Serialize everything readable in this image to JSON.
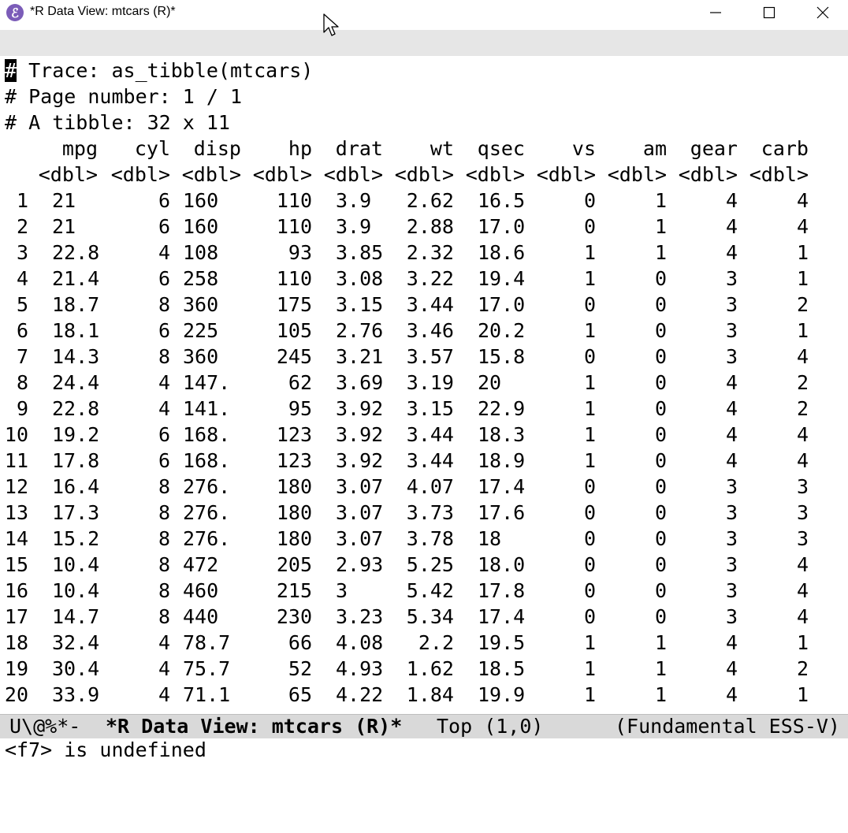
{
  "window": {
    "title": "*R Data View: mtcars (R)*",
    "app_icon_glyph": "ℰ",
    "buttons": [
      "minimize-icon",
      "maximize-icon",
      "close-icon"
    ]
  },
  "header_lines": {
    "trace_hash": "#",
    "trace_rest": " Trace: as_tibble(mtcars)",
    "page": "# Page number: 1 / 1",
    "tibble": "# A tibble: 32 x 11"
  },
  "table": {
    "columns": [
      "mpg",
      "cyl",
      "disp",
      "hp",
      "drat",
      "wt",
      "qsec",
      "vs",
      "am",
      "gear",
      "carb"
    ],
    "types": [
      "<dbl>",
      "<dbl>",
      "<dbl>",
      "<dbl>",
      "<dbl>",
      "<dbl>",
      "<dbl>",
      "<dbl>",
      "<dbl>",
      "<dbl>",
      "<dbl>"
    ],
    "rows": [
      [
        "1",
        "21",
        "6",
        "160",
        "110",
        "3.9",
        "2.62",
        "16.5",
        "0",
        "1",
        "4",
        "4"
      ],
      [
        "2",
        "21",
        "6",
        "160",
        "110",
        "3.9",
        "2.88",
        "17.0",
        "0",
        "1",
        "4",
        "4"
      ],
      [
        "3",
        "22.8",
        "4",
        "108",
        "93",
        "3.85",
        "2.32",
        "18.6",
        "1",
        "1",
        "4",
        "1"
      ],
      [
        "4",
        "21.4",
        "6",
        "258",
        "110",
        "3.08",
        "3.22",
        "19.4",
        "1",
        "0",
        "3",
        "1"
      ],
      [
        "5",
        "18.7",
        "8",
        "360",
        "175",
        "3.15",
        "3.44",
        "17.0",
        "0",
        "0",
        "3",
        "2"
      ],
      [
        "6",
        "18.1",
        "6",
        "225",
        "105",
        "2.76",
        "3.46",
        "20.2",
        "1",
        "0",
        "3",
        "1"
      ],
      [
        "7",
        "14.3",
        "8",
        "360",
        "245",
        "3.21",
        "3.57",
        "15.8",
        "0",
        "0",
        "3",
        "4"
      ],
      [
        "8",
        "24.4",
        "4",
        "147.",
        "62",
        "3.69",
        "3.19",
        "20",
        "1",
        "0",
        "4",
        "2"
      ],
      [
        "9",
        "22.8",
        "4",
        "141.",
        "95",
        "3.92",
        "3.15",
        "22.9",
        "1",
        "0",
        "4",
        "2"
      ],
      [
        "10",
        "19.2",
        "6",
        "168.",
        "123",
        "3.92",
        "3.44",
        "18.3",
        "1",
        "0",
        "4",
        "4"
      ],
      [
        "11",
        "17.8",
        "6",
        "168.",
        "123",
        "3.92",
        "3.44",
        "18.9",
        "1",
        "0",
        "4",
        "4"
      ],
      [
        "12",
        "16.4",
        "8",
        "276.",
        "180",
        "3.07",
        "4.07",
        "17.4",
        "0",
        "0",
        "3",
        "3"
      ],
      [
        "13",
        "17.3",
        "8",
        "276.",
        "180",
        "3.07",
        "3.73",
        "17.6",
        "0",
        "0",
        "3",
        "3"
      ],
      [
        "14",
        "15.2",
        "8",
        "276.",
        "180",
        "3.07",
        "3.78",
        "18",
        "0",
        "0",
        "3",
        "3"
      ],
      [
        "15",
        "10.4",
        "8",
        "472",
        "205",
        "2.93",
        "5.25",
        "18.0",
        "0",
        "0",
        "3",
        "4"
      ],
      [
        "16",
        "10.4",
        "8",
        "460",
        "215",
        "3",
        "5.42",
        "17.8",
        "0",
        "0",
        "3",
        "4"
      ],
      [
        "17",
        "14.7",
        "8",
        "440",
        "230",
        "3.23",
        "5.34",
        "17.4",
        "0",
        "0",
        "3",
        "4"
      ],
      [
        "18",
        "32.4",
        "4",
        "78.7",
        "66",
        "4.08",
        "2.2",
        "19.5",
        "1",
        "1",
        "4",
        "1"
      ],
      [
        "19",
        "30.4",
        "4",
        "75.7",
        "52",
        "4.93",
        "1.62",
        "18.5",
        "1",
        "1",
        "4",
        "2"
      ],
      [
        "20",
        "33.9",
        "4",
        "71.1",
        "65",
        "4.22",
        "1.84",
        "19.9",
        "1",
        "1",
        "4",
        "1"
      ]
    ]
  },
  "modeline": {
    "status": "U\\@%*-",
    "buffer_name": "*R Data View: mtcars (R)*",
    "position": "Top (1,0)",
    "modes": "(Fundamental ESS-V)"
  },
  "minibuffer": {
    "message": "<f7> is undefined"
  }
}
